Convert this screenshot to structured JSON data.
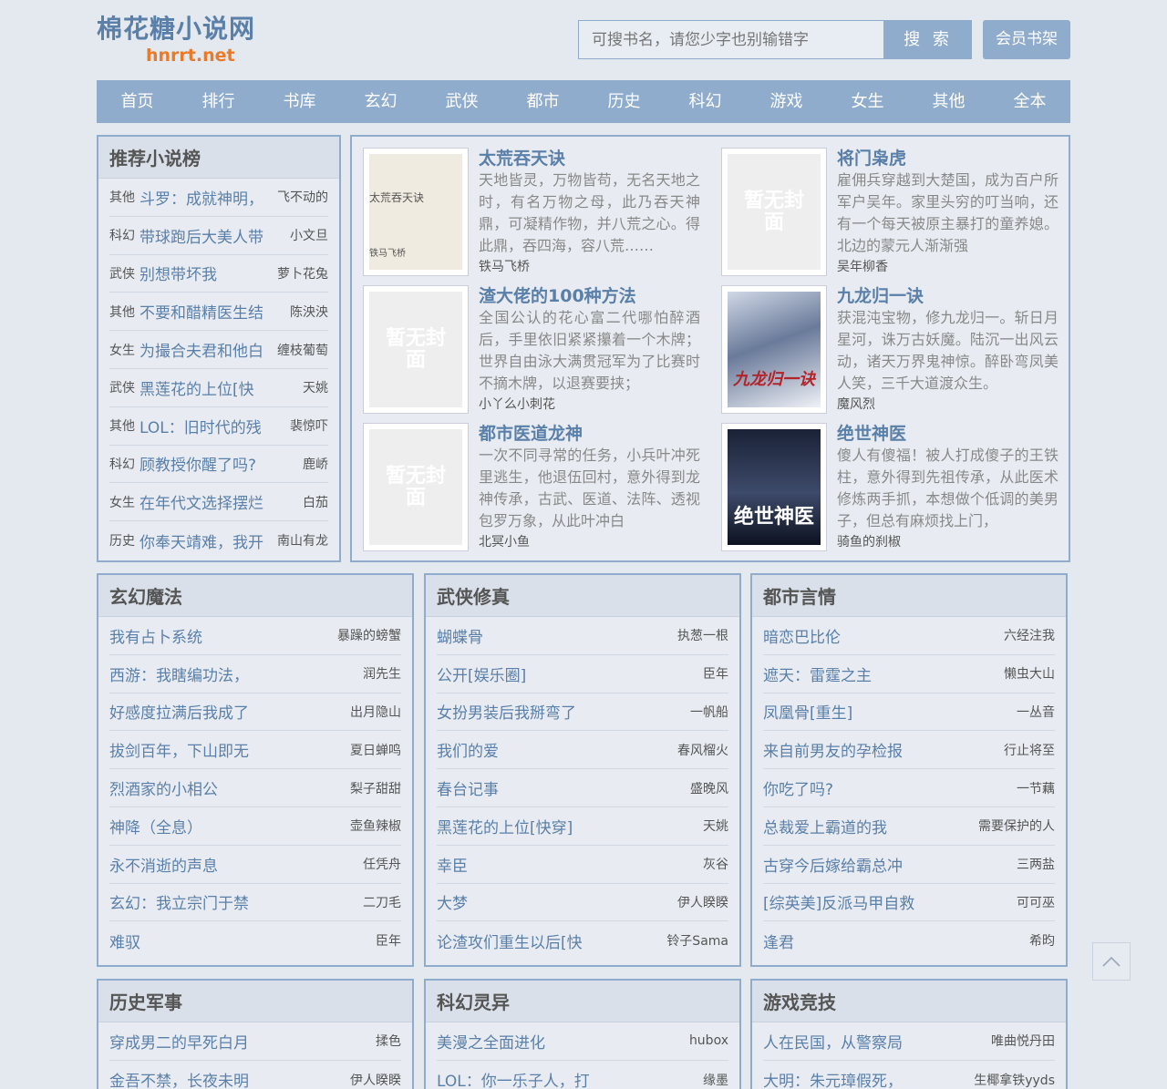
{
  "site": {
    "logo_cn": "棉花糖小说网",
    "logo_en": "hnrrt.net"
  },
  "search": {
    "placeholder": "可搜书名，请您少字也别输错字",
    "button": "搜 索"
  },
  "vip_button": "会员书架",
  "nav": [
    "首页",
    "排行",
    "书库",
    "玄幻",
    "武侠",
    "都市",
    "历史",
    "科幻",
    "游戏",
    "女生",
    "其他",
    "全本"
  ],
  "recommend": {
    "title": "推荐小说榜",
    "items": [
      {
        "cat": "其他",
        "name": "斗罗：成就神明，",
        "author": "飞不动的"
      },
      {
        "cat": "科幻",
        "name": "带球跑后大美人带",
        "author": "小文旦"
      },
      {
        "cat": "武侠",
        "name": "别想带坏我",
        "author": "萝卜花兔"
      },
      {
        "cat": "其他",
        "name": "不要和醋精医生结",
        "author": "陈泱泱"
      },
      {
        "cat": "女生",
        "name": "为撮合夫君和他白",
        "author": "缠枝葡萄"
      },
      {
        "cat": "武侠",
        "name": "黑莲花的上位[快",
        "author": "天姚"
      },
      {
        "cat": "其他",
        "name": "LOL：旧时代的残",
        "author": "裴惊吓"
      },
      {
        "cat": "科幻",
        "name": "顾教授你醒了吗?",
        "author": "鹿峤"
      },
      {
        "cat": "女生",
        "name": "在年代文选择摆烂",
        "author": "白茄"
      },
      {
        "cat": "历史",
        "name": "你奉天靖难，我开",
        "author": "南山有龙"
      }
    ]
  },
  "featured": [
    {
      "title": "太荒吞天诀",
      "desc": "天地皆灵，万物皆苟，无名天地之时，有名万物之母，此乃吞天神鼎，可凝精作物，并八荒之心。得此鼎，吞四海，容八荒……",
      "author": "铁马飞桥",
      "cover": "plain",
      "cover_title": "太荒吞天诀",
      "cover_sub": "铁马飞桥"
    },
    {
      "title": "将门枭虎",
      "desc": "雇佣兵穿越到大楚国，成为百户所军户吴年。家里头穷的叮当响，还有一个每天被原主暴打的童养媳。北边的蒙元人渐渐强",
      "author": "吴年柳香",
      "cover": "none",
      "cover_title": "暂无封面"
    },
    {
      "title": "渣大佬的100种方法",
      "desc": "全国公认的花心富二代哪怕醉酒后，手里依旧紧紧攥着一个木牌；世界自由泳大满贯冠军为了比赛时不摘木牌，以退赛要挟；",
      "author": "小丫么小刺花",
      "cover": "none",
      "cover_title": "暂无封面"
    },
    {
      "title": "九龙归一诀",
      "desc": "获混沌宝物，修九龙归一。斩日月星河，诛万古妖魔。陆沉一出风云动，诸天万界鬼神惊。醉卧弯凤美人笑，三千大道渡众生。",
      "author": "魔风烈",
      "cover": "dragon",
      "cover_title": "九龙归一诀"
    },
    {
      "title": "都市医道龙神",
      "desc": "一次不同寻常的任务，小兵叶冲死里逃生，他退伍回村，意外得到龙神传承，古武、医道、法阵、透视包罗万象，从此叶冲白",
      "author": "北冥小鱼",
      "cover": "none",
      "cover_title": "暂无封面"
    },
    {
      "title": "绝世神医",
      "desc": "傻人有傻福！被人打成傻子的王铁柱，意外得到先祖传承，从此医术修炼两手抓，本想做个低调的美男子，但总有麻烦找上门，",
      "author": "骑鱼的刹椒",
      "cover": "doctor",
      "cover_title": "绝世神医"
    }
  ],
  "categories": [
    {
      "title": "玄幻魔法",
      "items": [
        {
          "name": "我有占卜系统",
          "author": "暴躁的螃蟹"
        },
        {
          "name": "西游：我瞎编功法，",
          "author": "润先生"
        },
        {
          "name": "好感度拉满后我成了",
          "author": "出月隐山"
        },
        {
          "name": "拔剑百年，下山即无",
          "author": "夏日蝉鸣"
        },
        {
          "name": "烈酒家的小相公",
          "author": "梨子甜甜"
        },
        {
          "name": "神降（全息）",
          "author": "壶鱼辣椒"
        },
        {
          "name": "永不消逝的声息",
          "author": "任凭舟"
        },
        {
          "name": "玄幻：我立宗门于禁",
          "author": "二刀毛"
        },
        {
          "name": "难驭",
          "author": "臣年"
        }
      ]
    },
    {
      "title": "武侠修真",
      "items": [
        {
          "name": "蝴蝶骨",
          "author": "执葱一根"
        },
        {
          "name": "公开[娱乐圈]",
          "author": "臣年"
        },
        {
          "name": "女扮男装后我掰弯了",
          "author": "一帆船"
        },
        {
          "name": "我们的爱",
          "author": "春风榴火"
        },
        {
          "name": "春台记事",
          "author": "盛晚风"
        },
        {
          "name": "黑莲花的上位[快穿]",
          "author": "天姚"
        },
        {
          "name": "幸臣",
          "author": "灰谷"
        },
        {
          "name": "大梦",
          "author": "伊人睽睽"
        },
        {
          "name": "论渣攻们重生以后[快",
          "author": "铃子Sama"
        }
      ]
    },
    {
      "title": "都市言情",
      "items": [
        {
          "name": "暗恋巴比伦",
          "author": "六经注我"
        },
        {
          "name": "遮天：雷霆之主",
          "author": "懒虫大山"
        },
        {
          "name": "凤凰骨[重生]",
          "author": "一丛音"
        },
        {
          "name": "来自前男友的孕检报",
          "author": "行止将至"
        },
        {
          "name": "你吃了吗?",
          "author": "一节藕"
        },
        {
          "name": "总裁爱上霸道的我",
          "author": "需要保护的人"
        },
        {
          "name": "古穿今后嫁给霸总冲",
          "author": "三两盐"
        },
        {
          "name": "[综英美]反派马甲自救",
          "author": "可可巫"
        },
        {
          "name": "逢君",
          "author": "希昀"
        }
      ]
    },
    {
      "title": "历史军事",
      "items": [
        {
          "name": "穿成男二的早死白月",
          "author": "揉色"
        },
        {
          "name": "金吾不禁，长夜未明",
          "author": "伊人睽睽"
        }
      ]
    },
    {
      "title": "科幻灵异",
      "items": [
        {
          "name": "美漫之全面进化",
          "author": "hubox"
        },
        {
          "name": "LOL：你一乐子人，打",
          "author": "缘墨"
        }
      ]
    },
    {
      "title": "游戏竞技",
      "items": [
        {
          "name": "人在民国，从警察局",
          "author": "唯曲悦丹田"
        },
        {
          "name": "大明：朱元璋假死，",
          "author": "生椰拿铁yyds"
        }
      ]
    }
  ],
  "icons": {
    "back_to_top": "chevron-up-icon"
  },
  "colors": {
    "accent": "#8faccc",
    "link": "#5a7fa8",
    "logo_en": "#e87a2a",
    "background": "#e4e9f0"
  }
}
